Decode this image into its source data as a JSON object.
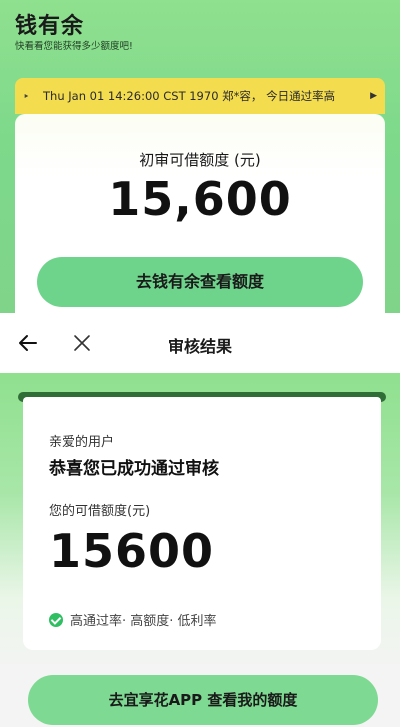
{
  "promo": {
    "brand": "钱有余",
    "slogan": "快看看您能获得多少额度吧!",
    "notice_text": "Thu Jan 01 14:26:00 CST 1970  郑*容，   今日通过率高",
    "credit_label": "初审可借额度 (元)",
    "credit_amount": "15,600",
    "button_label": "去钱有余查看额度"
  },
  "result": {
    "nav_title": "审核结果",
    "greeting": "亲爱的用户",
    "congrats": "恭喜您已成功通过审核",
    "credit_label": "您的可借额度(元)",
    "credit_amount": "15600",
    "features": "高通过率· 高额度· 低利率",
    "button_label": "去宜享花APP 查看我的额度"
  },
  "colors": {
    "brand_green": "#7ed98b",
    "notice_yellow": "#f4dc4f",
    "button_green": "#6fd48b",
    "check_green": "#2fbf63"
  }
}
